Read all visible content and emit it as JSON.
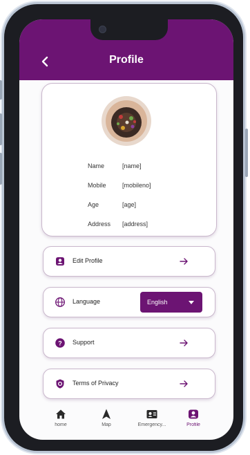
{
  "header": {
    "title": "Profile"
  },
  "profile": {
    "fields": [
      {
        "label": "Name",
        "value": "[name]"
      },
      {
        "label": "Mobile",
        "value": "[mobileno]"
      },
      {
        "label": "Age",
        "value": "[age]"
      },
      {
        "label": "Address",
        "value": "[address]"
      }
    ]
  },
  "menu": {
    "edit_profile": "Edit Profile",
    "language": "Language",
    "language_selected": "English",
    "support": "Support",
    "terms": "Terms of Privacy"
  },
  "tabs": [
    {
      "label": "home",
      "icon": "home-icon"
    },
    {
      "label": "Map",
      "icon": "navigation-icon"
    },
    {
      "label": "Emergency...",
      "icon": "id-card-icon"
    },
    {
      "label": "Profile",
      "icon": "profile-icon"
    }
  ],
  "colors": {
    "brand": "#6c1473",
    "background": "#fbfbfc",
    "border": "#c9b7cc"
  }
}
